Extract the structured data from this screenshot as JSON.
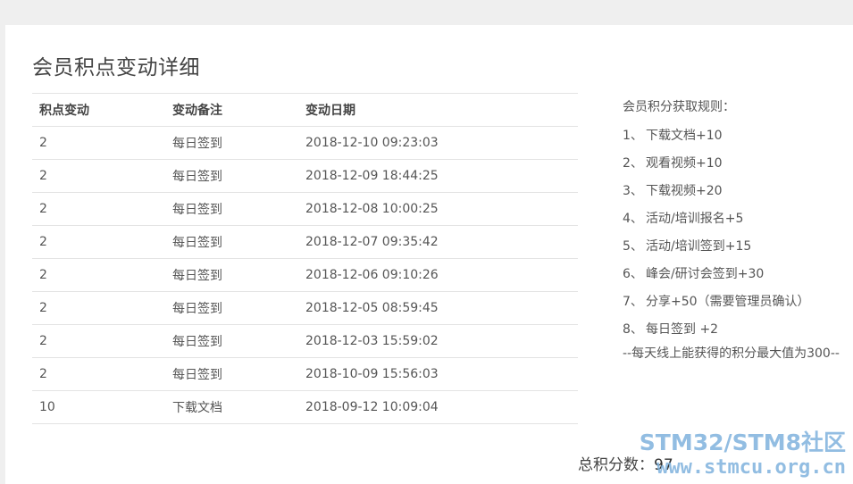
{
  "page": {
    "title": "会员积点变动详细"
  },
  "table": {
    "headers": [
      "积点变动",
      "变动备注",
      "变动日期"
    ],
    "rows": [
      {
        "change": "2",
        "note": "每日签到",
        "date": "2018-12-10 09:23:03"
      },
      {
        "change": "2",
        "note": "每日签到",
        "date": "2018-12-09 18:44:25"
      },
      {
        "change": "2",
        "note": "每日签到",
        "date": "2018-12-08 10:00:25"
      },
      {
        "change": "2",
        "note": "每日签到",
        "date": "2018-12-07 09:35:42"
      },
      {
        "change": "2",
        "note": "每日签到",
        "date": "2018-12-06 09:10:26"
      },
      {
        "change": "2",
        "note": "每日签到",
        "date": "2018-12-05 08:59:45"
      },
      {
        "change": "2",
        "note": "每日签到",
        "date": "2018-12-03 15:59:02"
      },
      {
        "change": "2",
        "note": "每日签到",
        "date": "2018-10-09 15:56:03"
      },
      {
        "change": "10",
        "note": "下载文档",
        "date": "2018-09-12 10:09:04"
      }
    ]
  },
  "rules": {
    "title": "会员积分获取规则：",
    "items": [
      {
        "num": "1、",
        "text": "下载文档+10"
      },
      {
        "num": "2、",
        "text": "观看视频+10"
      },
      {
        "num": "3、",
        "text": "下载视频+20"
      },
      {
        "num": "4、",
        "text": "活动/培训报名+5"
      },
      {
        "num": "5、",
        "text": "活动/培训签到+15"
      },
      {
        "num": "6、",
        "text": "峰会/研讨会签到+30"
      },
      {
        "num": "7、",
        "text": "分享+50（需要管理员确认）"
      },
      {
        "num": "8、",
        "text": "每日签到 +2"
      }
    ],
    "footer": "--每天线上能获得的积分最大值为300--"
  },
  "total": {
    "label": "总积分数：",
    "value": "97"
  },
  "watermark": {
    "line1": "STM32/STM8社区",
    "line2": "www.stmcu.org.cn"
  }
}
